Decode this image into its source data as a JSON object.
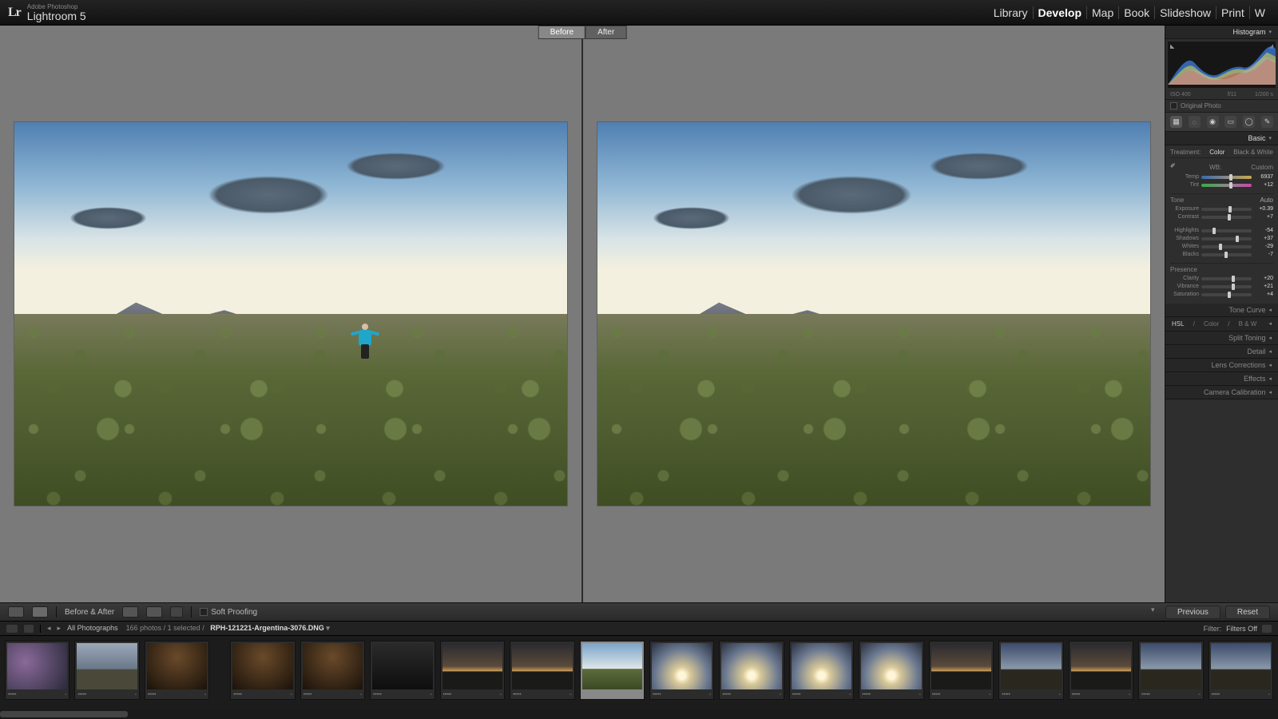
{
  "app": {
    "pretitle": "Adobe Photoshop",
    "title": "Lightroom 5",
    "logo": "Lr"
  },
  "nav": {
    "items": [
      "Library",
      "Develop",
      "Map",
      "Book",
      "Slideshow",
      "Print",
      "W"
    ],
    "active": "Develop"
  },
  "compare": {
    "before": "Before",
    "after": "After"
  },
  "rpanel": {
    "histogram_label": "Histogram",
    "meta": {
      "iso": "ISO 400",
      "focal": "",
      "aperture": "f/11",
      "shutter": "1/200 s"
    },
    "original_photo": "Original Photo",
    "basic": {
      "label": "Basic",
      "treatment": {
        "label": "Treatment:",
        "color": "Color",
        "bw": "Black & White"
      },
      "wb": {
        "label": "WB:",
        "value": "Custom"
      },
      "temp": {
        "label": "Temp",
        "value": "6937"
      },
      "tint": {
        "label": "Tint",
        "value": "+12"
      },
      "tone": {
        "label": "Tone",
        "auto": "Auto"
      },
      "exposure": {
        "label": "Exposure",
        "value": "+0.39"
      },
      "contrast": {
        "label": "Contrast",
        "value": "+7"
      },
      "highlights": {
        "label": "Highlights",
        "value": "-54"
      },
      "shadows": {
        "label": "Shadows",
        "value": "+37"
      },
      "whites": {
        "label": "Whites",
        "value": "-29"
      },
      "blacks": {
        "label": "Blacks",
        "value": "-7"
      },
      "presence": {
        "label": "Presence"
      },
      "clarity": {
        "label": "Clarity",
        "value": "+20"
      },
      "vibrance": {
        "label": "Vibrance",
        "value": "+21"
      },
      "saturation": {
        "label": "Saturation",
        "value": "+4"
      }
    },
    "sections": {
      "tonecurve": "Tone Curve",
      "hsl": {
        "hsl": "HSL",
        "color": "Color",
        "bw": "B & W"
      },
      "split": "Split Toning",
      "detail": "Detail",
      "lens": "Lens Corrections",
      "effects": "Effects",
      "cal": "Camera Calibration"
    }
  },
  "midbar": {
    "mode": "Before & After",
    "softproof": "Soft Proofing",
    "previous": "Previous",
    "reset": "Reset"
  },
  "filmstrip": {
    "breadcrumb_all": "All Photographs",
    "breadcrumb_count": "166 photos / 1 selected /",
    "breadcrumb_file": "RPH-121221-Argentina-3076.DNG",
    "filter_label": "Filter:",
    "filter_value": "Filters Off"
  }
}
